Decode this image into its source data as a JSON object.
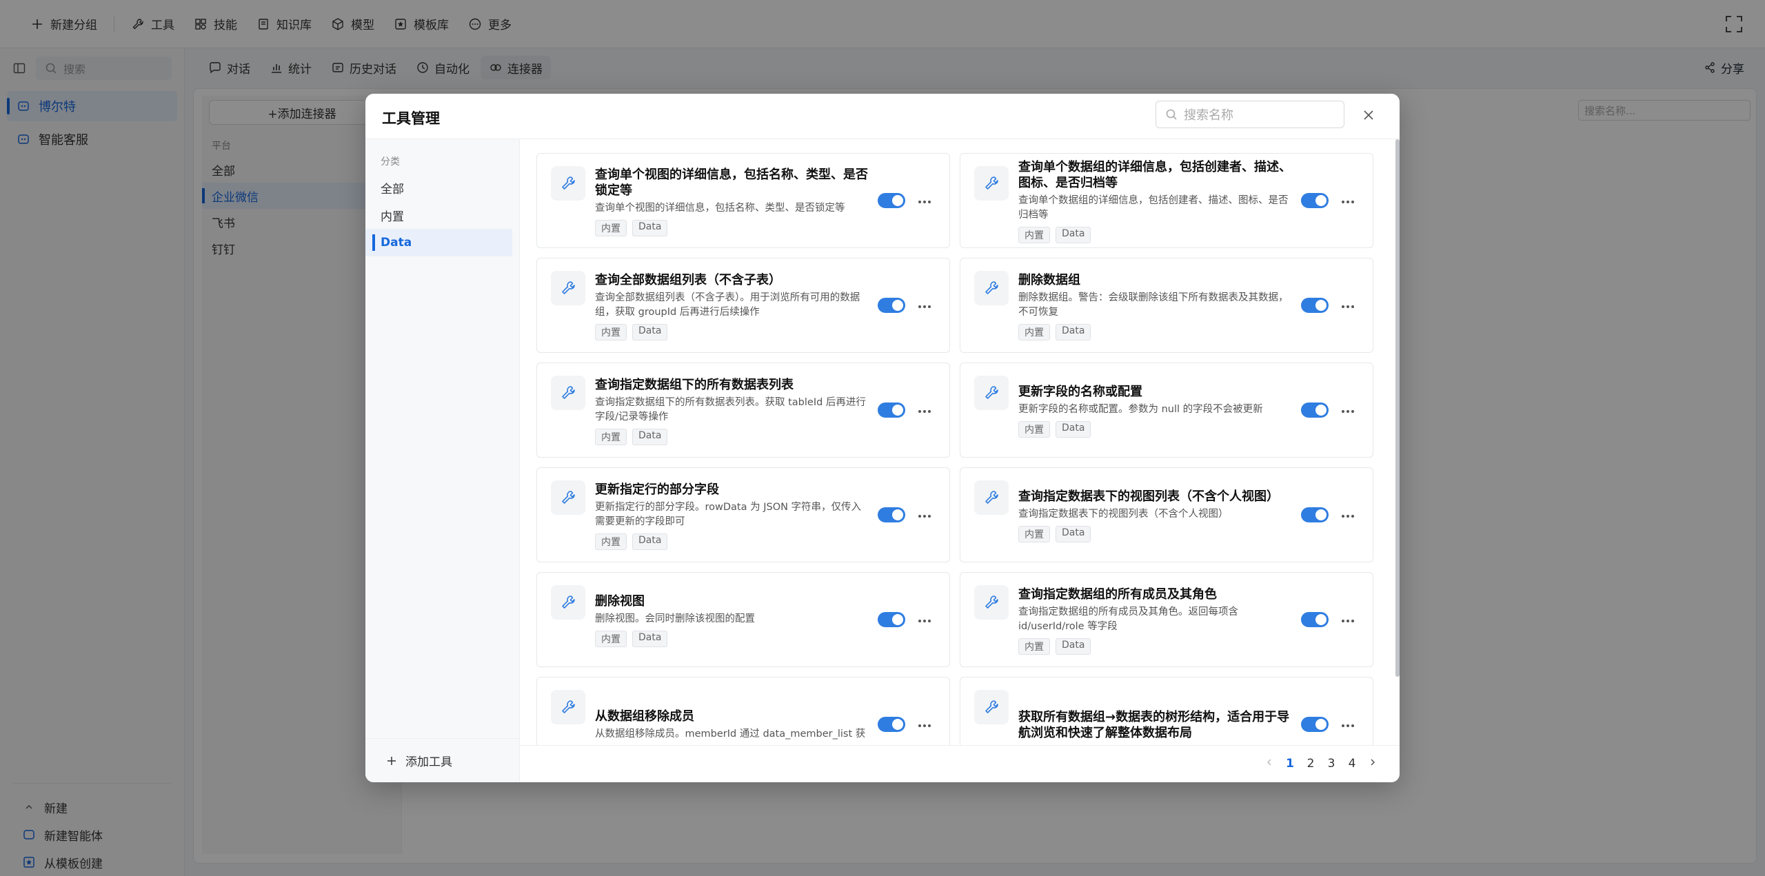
{
  "topbar": {
    "items": [
      {
        "label": "新建分组",
        "icon": "plus-icon"
      },
      {
        "label": "工具",
        "icon": "wrench-icon"
      },
      {
        "label": "技能",
        "icon": "skill-icon"
      },
      {
        "label": "知识库",
        "icon": "book-icon"
      },
      {
        "label": "模型",
        "icon": "cube-icon"
      },
      {
        "label": "模板库",
        "icon": "template-icon"
      },
      {
        "label": "更多",
        "icon": "more-circle-icon"
      }
    ]
  },
  "left_panel": {
    "search_placeholder": "搜索",
    "agents": [
      {
        "label": "博尔特",
        "active": true
      },
      {
        "label": "智能客服",
        "active": false
      }
    ],
    "bottom": {
      "new_label": "新建",
      "new_agent": "新建智能体",
      "from_template": "从模板创建"
    }
  },
  "subbar": {
    "tabs": [
      {
        "label": "对话",
        "icon": "chat-icon"
      },
      {
        "label": "统计",
        "icon": "chart-icon"
      },
      {
        "label": "历史对话",
        "icon": "history-icon"
      },
      {
        "label": "自动化",
        "icon": "automation-icon"
      },
      {
        "label": "连接器",
        "icon": "connector-icon",
        "active": true
      }
    ],
    "share_label": "分享"
  },
  "connector_panel": {
    "add_label": "+添加连接器",
    "section_label": "平台",
    "items": [
      {
        "label": "全部",
        "active": false
      },
      {
        "label": "企业微信",
        "active": true
      },
      {
        "label": "飞书",
        "active": false
      },
      {
        "label": "钉钉",
        "active": false
      }
    ],
    "search_placeholder": "搜索名称..."
  },
  "modal": {
    "title": "工具管理",
    "search_placeholder": "搜索名称",
    "side_label": "分类",
    "categories": [
      {
        "label": "全部",
        "active": false
      },
      {
        "label": "内置",
        "active": false
      },
      {
        "label": "Data",
        "active": true
      }
    ],
    "add_tool_label": "添加工具",
    "tools": [
      {
        "title": "查询单个视图的详细信息，包括名称、类型、是否锁定等",
        "desc": "查询单个视图的详细信息，包括名称、类型、是否锁定等",
        "tags": [
          "内置",
          "Data"
        ],
        "enabled": true
      },
      {
        "title": "查询单个数据组的详细信息，包括创建者、描述、图标、是否归档等",
        "desc": "查询单个数据组的详细信息，包括创建者、描述、图标、是否归档等",
        "tags": [
          "内置",
          "Data"
        ],
        "enabled": true
      },
      {
        "title": "查询全部数据组列表（不含子表）",
        "desc": "查询全部数据组列表（不含子表）。用于浏览所有可用的数据组，获取 groupId 后再进行后续操作",
        "tags": [
          "内置",
          "Data"
        ],
        "enabled": true
      },
      {
        "title": "删除数据组",
        "desc": "删除数据组。警告：会级联删除该组下所有数据表及其数据，不可恢复",
        "tags": [
          "内置",
          "Data"
        ],
        "enabled": true
      },
      {
        "title": "查询指定数据组下的所有数据表列表",
        "desc": "查询指定数据组下的所有数据表列表。获取 tableId 后再进行字段/记录等操作",
        "tags": [
          "内置",
          "Data"
        ],
        "enabled": true
      },
      {
        "title": "更新字段的名称或配置",
        "desc": "更新字段的名称或配置。参数为 null 的字段不会被更新",
        "tags": [
          "内置",
          "Data"
        ],
        "enabled": true
      },
      {
        "title": "更新指定行的部分字段",
        "desc": "更新指定行的部分字段。rowData 为 JSON 字符串，仅传入需要更新的字段即可",
        "tags": [
          "内置",
          "Data"
        ],
        "enabled": true
      },
      {
        "title": "查询指定数据表下的视图列表（不含个人视图）",
        "desc": "查询指定数据表下的视图列表（不含个人视图）",
        "tags": [
          "内置",
          "Data"
        ],
        "enabled": true
      },
      {
        "title": "删除视图",
        "desc": "删除视图。会同时删除该视图的配置",
        "tags": [
          "内置",
          "Data"
        ],
        "enabled": true
      },
      {
        "title": "查询指定数据组的所有成员及其角色",
        "desc": "查询指定数据组的所有成员及其角色。返回每项含 id/userId/role 等字段",
        "tags": [
          "内置",
          "Data"
        ],
        "enabled": true
      },
      {
        "title": "从数据组移除成员",
        "desc": "从数据组移除成员。memberId 通过 data_member_list 获",
        "tags": [],
        "enabled": true
      },
      {
        "title": "获取所有数据组→数据表的树形结构，适合用于导航浏览和快速了解整体数据布局",
        "desc": "",
        "tags": [],
        "enabled": true
      }
    ],
    "pagination": {
      "pages": [
        "1",
        "2",
        "3",
        "4"
      ],
      "current": "1"
    }
  },
  "colors": {
    "accent": "#1668dc",
    "toggle_on": "#2f7de1",
    "overlay": "rgba(0,0,0,0.45)"
  }
}
